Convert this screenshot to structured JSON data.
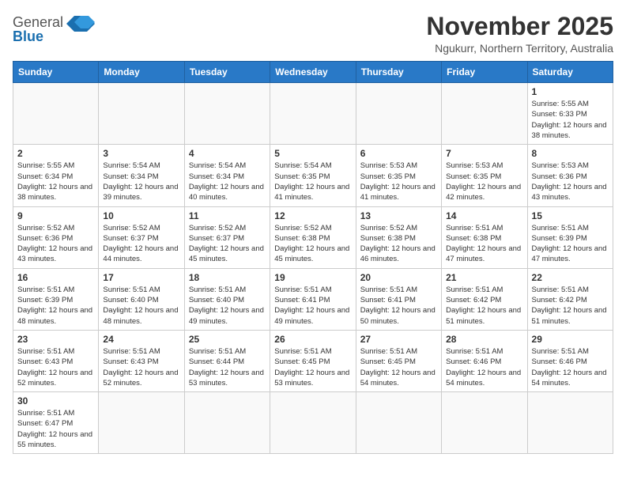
{
  "header": {
    "logo_line1": "General",
    "logo_line2": "Blue",
    "month_title": "November 2025",
    "location": "Ngukurr, Northern Territory, Australia"
  },
  "days_of_week": [
    "Sunday",
    "Monday",
    "Tuesday",
    "Wednesday",
    "Thursday",
    "Friday",
    "Saturday"
  ],
  "weeks": [
    [
      {
        "day": "",
        "info": ""
      },
      {
        "day": "",
        "info": ""
      },
      {
        "day": "",
        "info": ""
      },
      {
        "day": "",
        "info": ""
      },
      {
        "day": "",
        "info": ""
      },
      {
        "day": "",
        "info": ""
      },
      {
        "day": "1",
        "info": "Sunrise: 5:55 AM\nSunset: 6:33 PM\nDaylight: 12 hours and 38 minutes."
      }
    ],
    [
      {
        "day": "2",
        "info": "Sunrise: 5:55 AM\nSunset: 6:34 PM\nDaylight: 12 hours and 38 minutes."
      },
      {
        "day": "3",
        "info": "Sunrise: 5:54 AM\nSunset: 6:34 PM\nDaylight: 12 hours and 39 minutes."
      },
      {
        "day": "4",
        "info": "Sunrise: 5:54 AM\nSunset: 6:34 PM\nDaylight: 12 hours and 40 minutes."
      },
      {
        "day": "5",
        "info": "Sunrise: 5:54 AM\nSunset: 6:35 PM\nDaylight: 12 hours and 41 minutes."
      },
      {
        "day": "6",
        "info": "Sunrise: 5:53 AM\nSunset: 6:35 PM\nDaylight: 12 hours and 41 minutes."
      },
      {
        "day": "7",
        "info": "Sunrise: 5:53 AM\nSunset: 6:35 PM\nDaylight: 12 hours and 42 minutes."
      },
      {
        "day": "8",
        "info": "Sunrise: 5:53 AM\nSunset: 6:36 PM\nDaylight: 12 hours and 43 minutes."
      }
    ],
    [
      {
        "day": "9",
        "info": "Sunrise: 5:52 AM\nSunset: 6:36 PM\nDaylight: 12 hours and 43 minutes."
      },
      {
        "day": "10",
        "info": "Sunrise: 5:52 AM\nSunset: 6:37 PM\nDaylight: 12 hours and 44 minutes."
      },
      {
        "day": "11",
        "info": "Sunrise: 5:52 AM\nSunset: 6:37 PM\nDaylight: 12 hours and 45 minutes."
      },
      {
        "day": "12",
        "info": "Sunrise: 5:52 AM\nSunset: 6:38 PM\nDaylight: 12 hours and 45 minutes."
      },
      {
        "day": "13",
        "info": "Sunrise: 5:52 AM\nSunset: 6:38 PM\nDaylight: 12 hours and 46 minutes."
      },
      {
        "day": "14",
        "info": "Sunrise: 5:51 AM\nSunset: 6:38 PM\nDaylight: 12 hours and 47 minutes."
      },
      {
        "day": "15",
        "info": "Sunrise: 5:51 AM\nSunset: 6:39 PM\nDaylight: 12 hours and 47 minutes."
      }
    ],
    [
      {
        "day": "16",
        "info": "Sunrise: 5:51 AM\nSunset: 6:39 PM\nDaylight: 12 hours and 48 minutes."
      },
      {
        "day": "17",
        "info": "Sunrise: 5:51 AM\nSunset: 6:40 PM\nDaylight: 12 hours and 48 minutes."
      },
      {
        "day": "18",
        "info": "Sunrise: 5:51 AM\nSunset: 6:40 PM\nDaylight: 12 hours and 49 minutes."
      },
      {
        "day": "19",
        "info": "Sunrise: 5:51 AM\nSunset: 6:41 PM\nDaylight: 12 hours and 49 minutes."
      },
      {
        "day": "20",
        "info": "Sunrise: 5:51 AM\nSunset: 6:41 PM\nDaylight: 12 hours and 50 minutes."
      },
      {
        "day": "21",
        "info": "Sunrise: 5:51 AM\nSunset: 6:42 PM\nDaylight: 12 hours and 51 minutes."
      },
      {
        "day": "22",
        "info": "Sunrise: 5:51 AM\nSunset: 6:42 PM\nDaylight: 12 hours and 51 minutes."
      }
    ],
    [
      {
        "day": "23",
        "info": "Sunrise: 5:51 AM\nSunset: 6:43 PM\nDaylight: 12 hours and 52 minutes."
      },
      {
        "day": "24",
        "info": "Sunrise: 5:51 AM\nSunset: 6:43 PM\nDaylight: 12 hours and 52 minutes."
      },
      {
        "day": "25",
        "info": "Sunrise: 5:51 AM\nSunset: 6:44 PM\nDaylight: 12 hours and 53 minutes."
      },
      {
        "day": "26",
        "info": "Sunrise: 5:51 AM\nSunset: 6:45 PM\nDaylight: 12 hours and 53 minutes."
      },
      {
        "day": "27",
        "info": "Sunrise: 5:51 AM\nSunset: 6:45 PM\nDaylight: 12 hours and 54 minutes."
      },
      {
        "day": "28",
        "info": "Sunrise: 5:51 AM\nSunset: 6:46 PM\nDaylight: 12 hours and 54 minutes."
      },
      {
        "day": "29",
        "info": "Sunrise: 5:51 AM\nSunset: 6:46 PM\nDaylight: 12 hours and 54 minutes."
      }
    ],
    [
      {
        "day": "30",
        "info": "Sunrise: 5:51 AM\nSunset: 6:47 PM\nDaylight: 12 hours and 55 minutes."
      },
      {
        "day": "",
        "info": ""
      },
      {
        "day": "",
        "info": ""
      },
      {
        "day": "",
        "info": ""
      },
      {
        "day": "",
        "info": ""
      },
      {
        "day": "",
        "info": ""
      },
      {
        "day": "",
        "info": ""
      }
    ]
  ]
}
